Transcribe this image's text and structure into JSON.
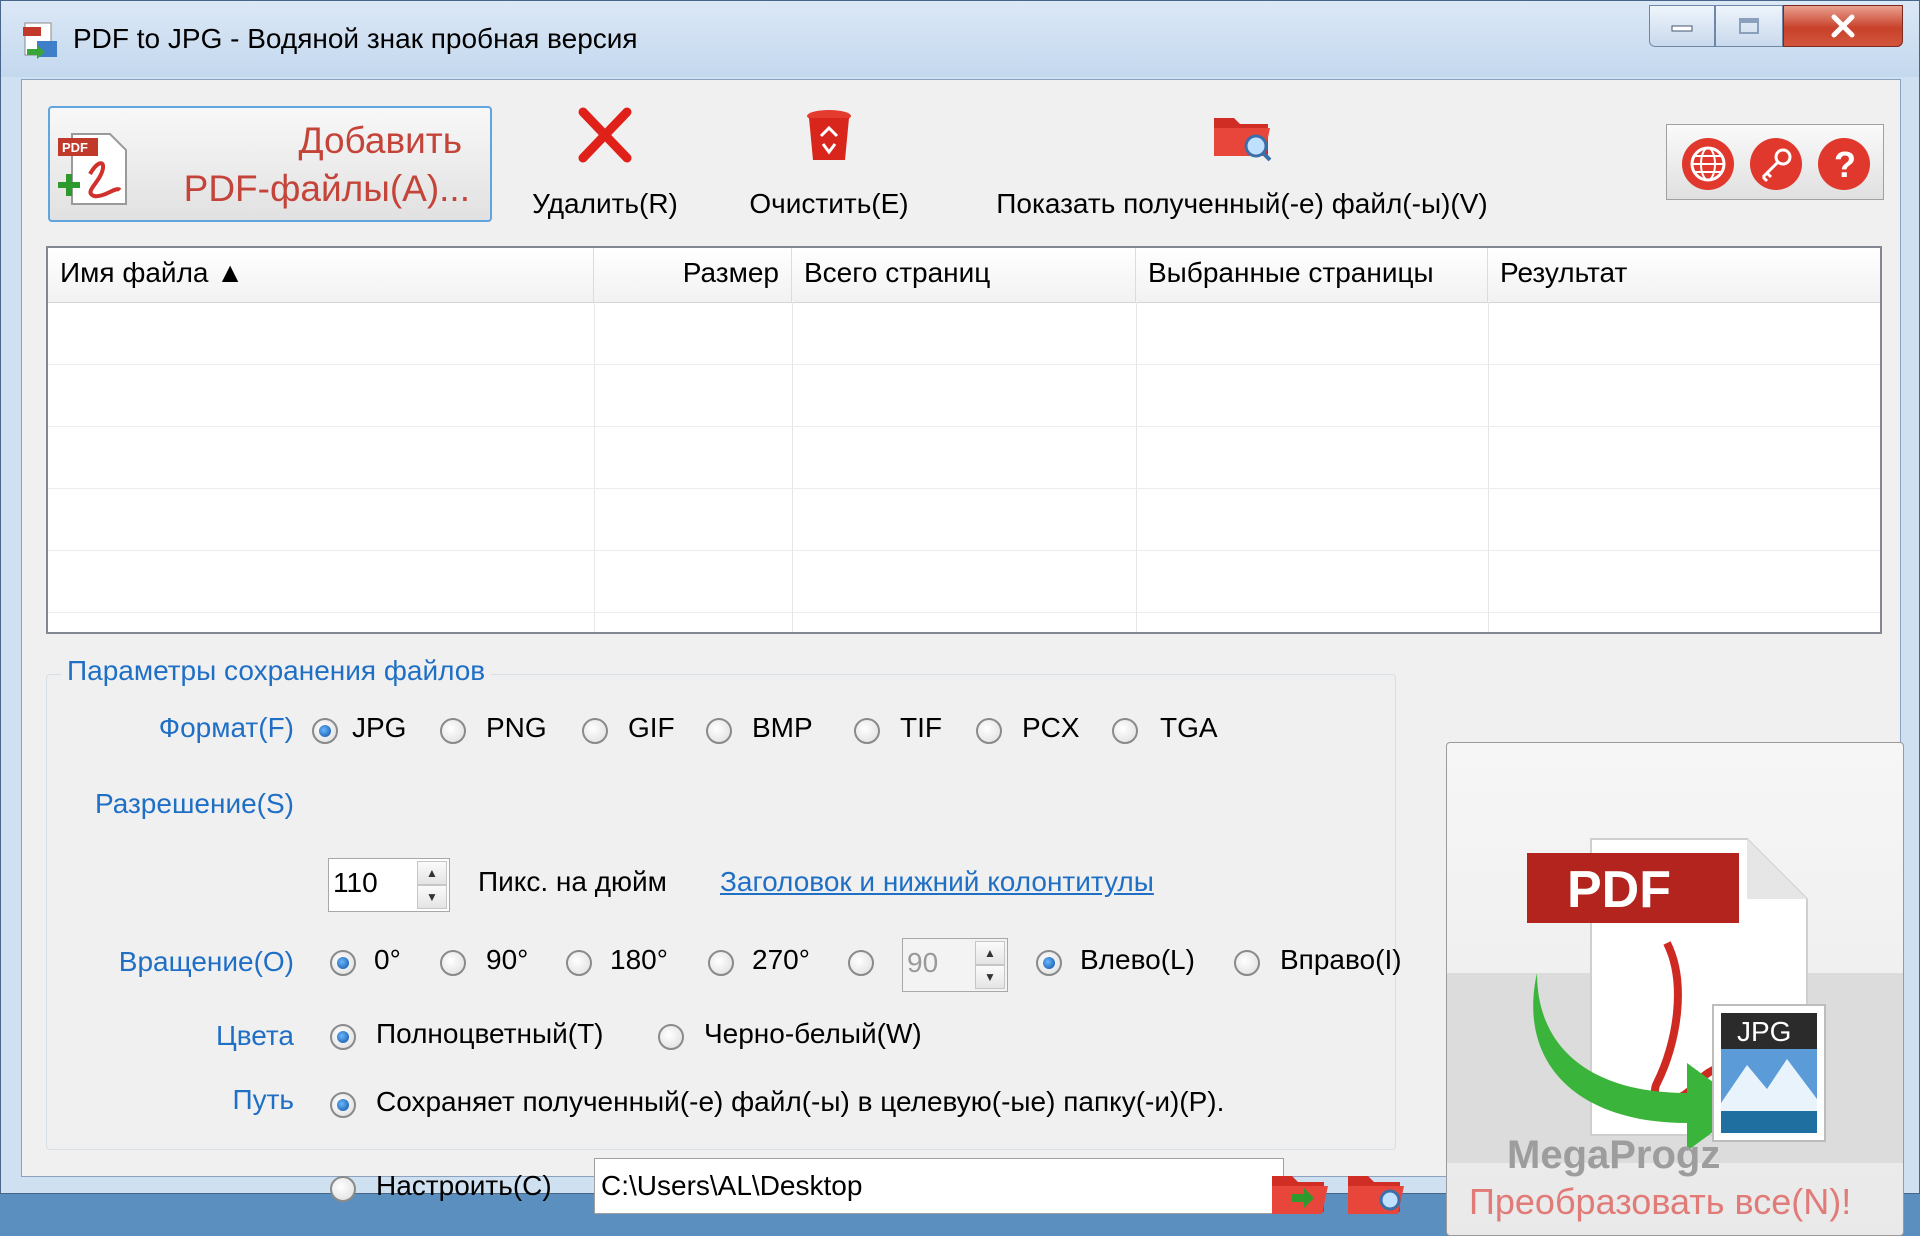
{
  "window": {
    "title": "PDF to JPG - Водяной знак пробная версия",
    "controls": {
      "minimize": "—",
      "maximize": "☐",
      "close": "✕"
    }
  },
  "toolbar": {
    "add_line1": "Добавить",
    "add_line2": "PDF-файлы(A)...",
    "delete_label": "Удалить(R)",
    "clear_label": "Очистить(E)",
    "show_label": "Показать полученный(-е) файл(-ы)(V)",
    "right_icons": [
      "globe-icon",
      "key-icon",
      "help-icon"
    ]
  },
  "table": {
    "columns": [
      "Имя файла ▲",
      "Размер",
      "Всего страниц",
      "Выбранные страницы",
      "Результат"
    ],
    "rows": []
  },
  "settings": {
    "group_title": "Параметры сохранения файлов",
    "format": {
      "label": "Формат(F)",
      "options": [
        "JPG",
        "PNG",
        "GIF",
        "BMP",
        "TIF",
        "PCX",
        "TGA"
      ],
      "selected": "JPG"
    },
    "resolution": {
      "label": "Разрешение(S)",
      "value": "110",
      "unit": "Пикс. на дюйм",
      "header_footer_link": "Заголовок и нижний колонтитулы"
    },
    "rotation": {
      "label": "Вращение(O)",
      "options": [
        "0°",
        "90°",
        "180°",
        "270°"
      ],
      "selected": "0°",
      "custom_value": "90",
      "direction_left": "Влево(L)",
      "direction_right": "Вправо(I)",
      "direction_selected": "Влево(L)"
    },
    "colors": {
      "label": "Цвета",
      "options": [
        "Полноцветный(T)",
        "Черно-белый(W)"
      ],
      "selected": "Полноцветный(T)"
    },
    "path": {
      "label": "Путь",
      "option_target": "Сохраняет полученный(-е) файл(-ы) в целевую(-ые) папку(-и)(P).",
      "option_custom": "Настроить(C)",
      "selected": "target",
      "custom_path": "C:\\Users\\AL\\Desktop"
    }
  },
  "preview": {
    "pdf_label": "PDF",
    "jpg_label": "JPG",
    "watermark": "MegaProgz",
    "convert_label": "Преобразовать все(N)!"
  }
}
